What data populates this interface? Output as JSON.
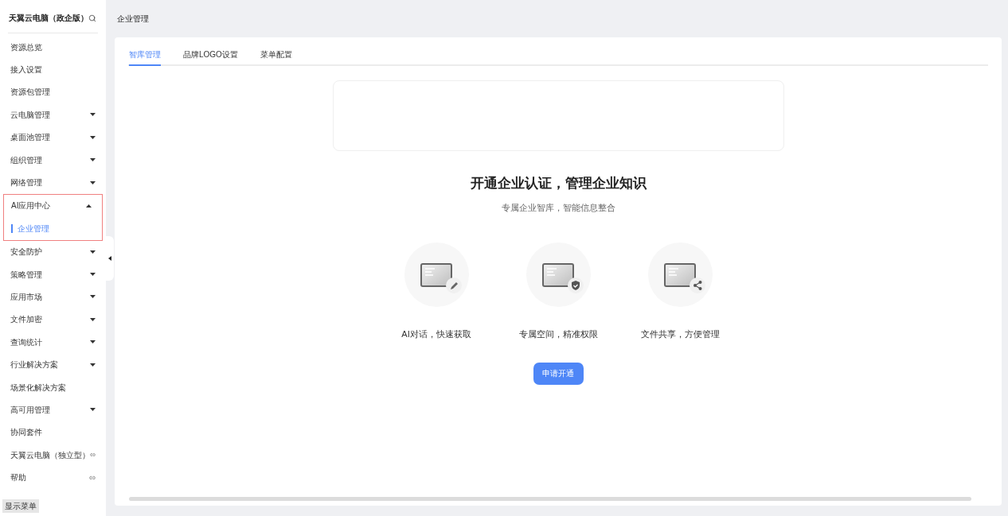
{
  "sidebar": {
    "title": "天翼云电脑（政企版）",
    "items": [
      {
        "label": "资源总览",
        "kind": "plain"
      },
      {
        "label": "接入设置",
        "kind": "plain"
      },
      {
        "label": "资源包管理",
        "kind": "plain"
      },
      {
        "label": "云电脑管理",
        "kind": "dropdown",
        "expanded": false
      },
      {
        "label": "桌面池管理",
        "kind": "dropdown",
        "expanded": false
      },
      {
        "label": "组织管理",
        "kind": "dropdown",
        "expanded": false
      },
      {
        "label": "网络管理",
        "kind": "dropdown",
        "expanded": false
      },
      {
        "label": "AI应用中心",
        "kind": "dropdown",
        "expanded": true,
        "highlighted": true,
        "children": [
          {
            "label": "企业管理",
            "selected": true
          }
        ]
      },
      {
        "label": "安全防护",
        "kind": "dropdown",
        "expanded": false
      },
      {
        "label": "策略管理",
        "kind": "dropdown",
        "expanded": false
      },
      {
        "label": "应用市场",
        "kind": "dropdown",
        "expanded": false
      },
      {
        "label": "文件加密",
        "kind": "dropdown",
        "expanded": false
      },
      {
        "label": "查询统计",
        "kind": "dropdown",
        "expanded": false
      },
      {
        "label": "行业解决方案",
        "kind": "dropdown",
        "expanded": false
      },
      {
        "label": "场景化解决方案",
        "kind": "plain"
      },
      {
        "label": "高可用管理",
        "kind": "dropdown",
        "expanded": false
      },
      {
        "label": "协同套件",
        "kind": "plain"
      },
      {
        "label": "天翼云电脑（独立型）",
        "kind": "link"
      },
      {
        "label": "帮助",
        "kind": "link"
      }
    ],
    "show_menu": "显示菜单"
  },
  "page_title": "企业管理",
  "tabs": [
    {
      "label": "智库管理",
      "selected": true
    },
    {
      "label": "品牌LOGO设置",
      "selected": false
    },
    {
      "label": "菜单配置",
      "selected": false
    }
  ],
  "promo": {
    "title": "开通企业认证，管理企业知识",
    "subtitle": "专属企业智库，智能信息整合",
    "features": [
      {
        "label": "AI对话，快速获取",
        "kind": "edit"
      },
      {
        "label": "专属空间，精准权限",
        "kind": "shield"
      },
      {
        "label": "文件共享，方便管理",
        "kind": "share"
      }
    ],
    "button": "申请开通"
  }
}
